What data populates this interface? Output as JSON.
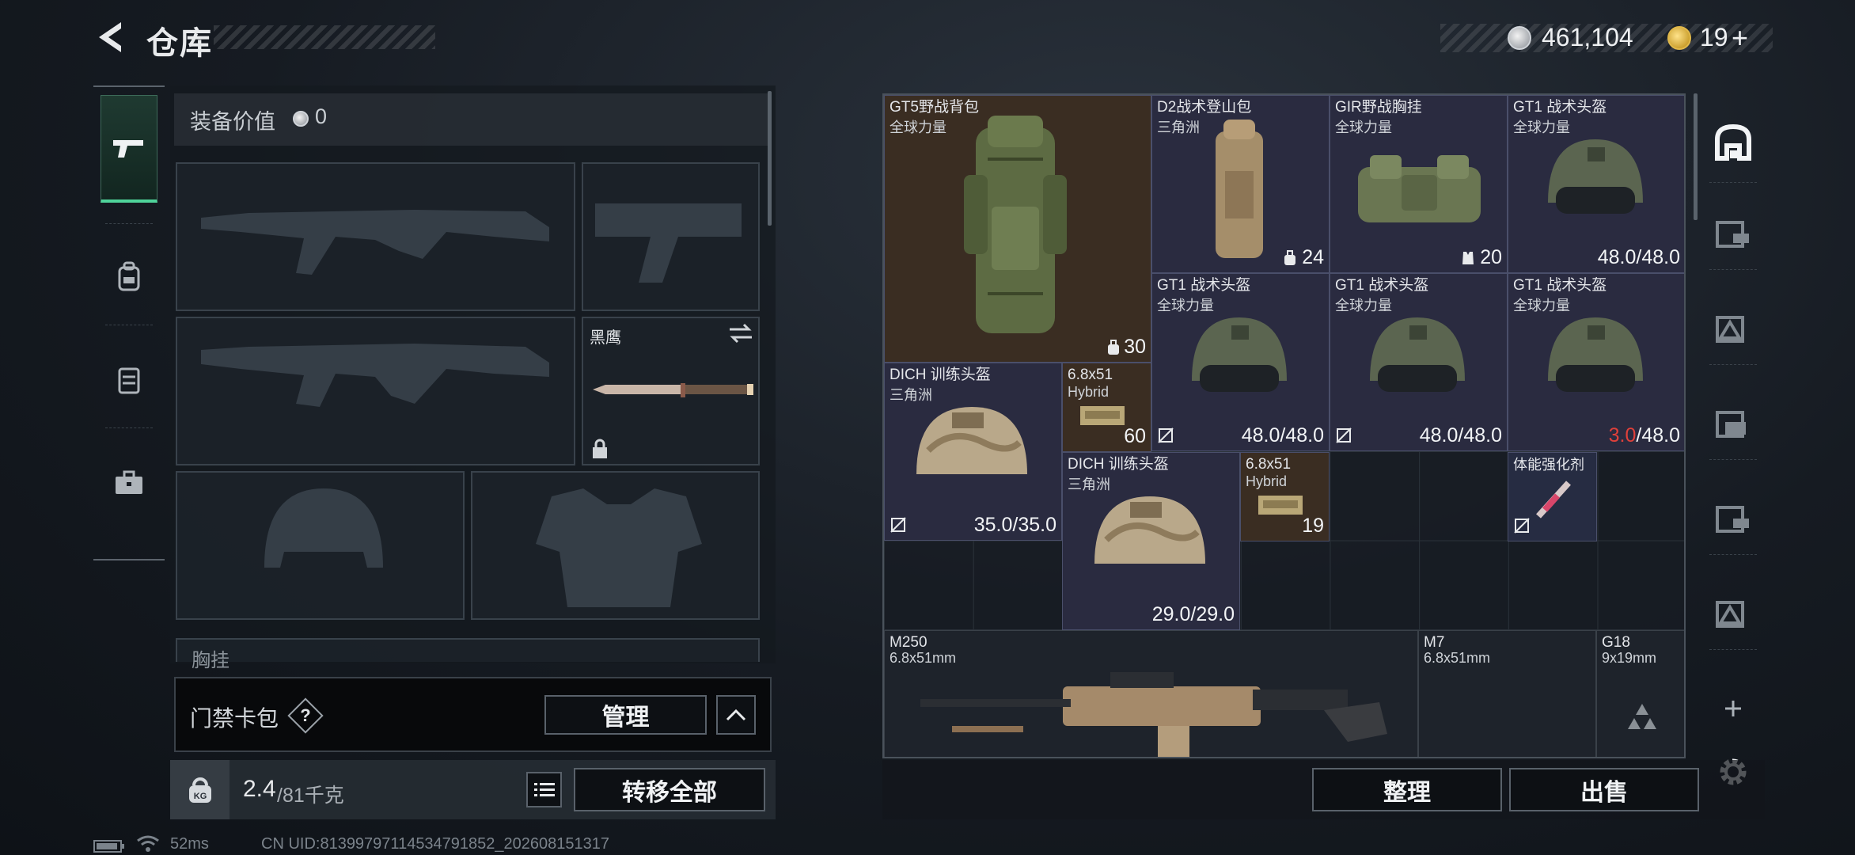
{
  "header": {
    "title": "仓库",
    "currency": {
      "silver": "461,104",
      "gold": "19",
      "gold_plus": "+"
    }
  },
  "loadout": {
    "value_label": "装备价值",
    "value": "0",
    "melee_name": "黑鹰",
    "chest_label": "胸挂"
  },
  "card_bag": {
    "label": "门禁卡包",
    "help": "?",
    "manage_label": "管理"
  },
  "weight": {
    "current": "2.4",
    "max": "/81千克",
    "transfer_label": "转移全部"
  },
  "storage": {
    "items": [
      {
        "name": "GT5野战背包",
        "sub": "全球力量",
        "count": "30",
        "count_icon": "capacity"
      },
      {
        "name": "D2战术登山包",
        "sub": "三角洲",
        "count": "24"
      },
      {
        "name": "GIR野战胸挂",
        "sub": "全球力量",
        "count": "20"
      },
      {
        "name": "GT1 战术头盔",
        "sub": "全球力量",
        "dur": "48.0/48.0"
      },
      {
        "name": "GT1 战术头盔",
        "sub": "全球力量",
        "dur": "48.0/48.0"
      },
      {
        "name": "GT1 战术头盔",
        "sub": "全球力量",
        "dur": "48.0/48.0"
      },
      {
        "name": "GT1 战术头盔",
        "sub": "全球力量",
        "dur_low": "3.0",
        "dur_max": "/48.0"
      },
      {
        "name": "DICH 训练头盔",
        "sub": "三角洲",
        "dur": "35.0/35.0"
      },
      {
        "name": "6.8x51",
        "sub": "Hybrid",
        "count": "60"
      },
      {
        "name": "DICH 训练头盔",
        "sub": "三角洲",
        "dur": "29.0/29.0"
      },
      {
        "name": "6.8x51",
        "sub": "Hybrid",
        "count": "19"
      },
      {
        "name": "体能强化剂",
        "sub": ""
      },
      {
        "name": "M250",
        "sub": "6.8x51mm"
      },
      {
        "name": "M7",
        "sub": "6.8x51mm"
      },
      {
        "name": "G18",
        "sub": "9x19mm"
      }
    ],
    "sort_label": "整理",
    "sell_label": "出售"
  },
  "status": {
    "ping": "52ms",
    "uid": "CN UID:813997971145347918​52_202608151317"
  },
  "colors": {
    "accent": "#4fd39a",
    "warning": "#e0403a"
  }
}
